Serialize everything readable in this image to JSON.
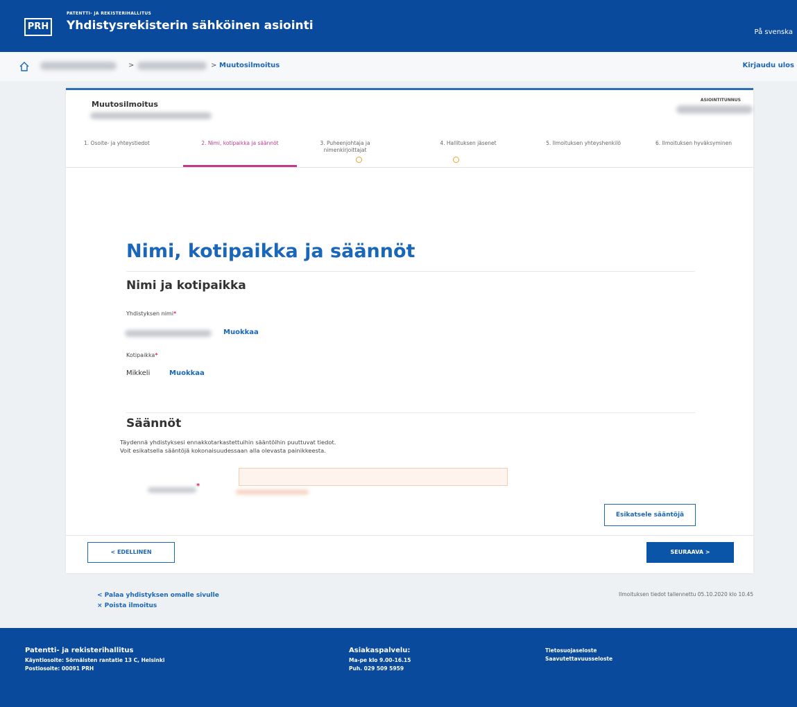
{
  "header": {
    "logo_text": "PRH",
    "org_name": "PATENTTI- JA REKISTERIHALLITUS",
    "app_title": "Yhdistysrekisterin sähköinen asiointi",
    "language_link": "På svenska"
  },
  "breadcrumb": {
    "separator": ">",
    "current": "Muutosilmoitus",
    "logout": "Kirjaudu ulos"
  },
  "card": {
    "title": "Muutosilmoitus",
    "id_label": "ASIOINTITUNNUS"
  },
  "steps": [
    {
      "label": "1. Osoite- ja yhteystiedot"
    },
    {
      "label": "2. Nimi, kotipaikka ja säännöt"
    },
    {
      "label": "3. Puheenjohtaja ja nimenkirjoittajat"
    },
    {
      "label": "4. Hallituksen jäsenet"
    },
    {
      "label": "5. Ilmoituksen yhteyshenkilö"
    },
    {
      "label": "6. Ilmoituksen hyväksyminen"
    }
  ],
  "main": {
    "heading": "Nimi, kotipaikka ja säännöt",
    "section_name": "Nimi ja kotipaikka",
    "name_label": "Yhdistyksen nimi",
    "edit_label": "Muokkaa",
    "home_label": "Kotipaikka",
    "home_value": "Mikkeli",
    "rules_heading": "Säännöt",
    "rules_desc_1": "Täydennä yhdistyksesi ennakkotarkastettuihin sääntöihin puuttuvat tiedot.",
    "rules_desc_2": "Voit esikatsella sääntöjä kokonaisuudessaan alla olevasta painikkeesta.",
    "preview_button": "Esikatsele sääntöjä",
    "required_mark": "*"
  },
  "nav": {
    "prev": "< EDELLINEN",
    "next": "SEURAAVA >"
  },
  "below": {
    "back_link": "< Palaa yhdistyksen omalle sivulle",
    "delete_link": "× Poista ilmoitus",
    "saved_note": "Ilmoituksen tiedot tallennettu 05.10.2020 klo 10.45"
  },
  "footer": {
    "org": "Patentti- ja rekisterihallitus",
    "visit": "Käyntiosoite: Sörnäisten rantatie 13 C, Helsinki",
    "post": "Postiosoite: 00091 PRH",
    "service_head": "Asiakaspalvelu:",
    "service_hours": "Ma-pe klo 9.00-16.15",
    "service_phone": "Puh. 029 509 5959",
    "privacy": "Tietosuojaseloste",
    "accessibility": "Saavutettavuusseloste"
  },
  "colors": {
    "brand_blue": "#0a4a9c",
    "link_blue": "#1a66b8",
    "active_step": "#c23a8e",
    "required": "#e0284b"
  }
}
